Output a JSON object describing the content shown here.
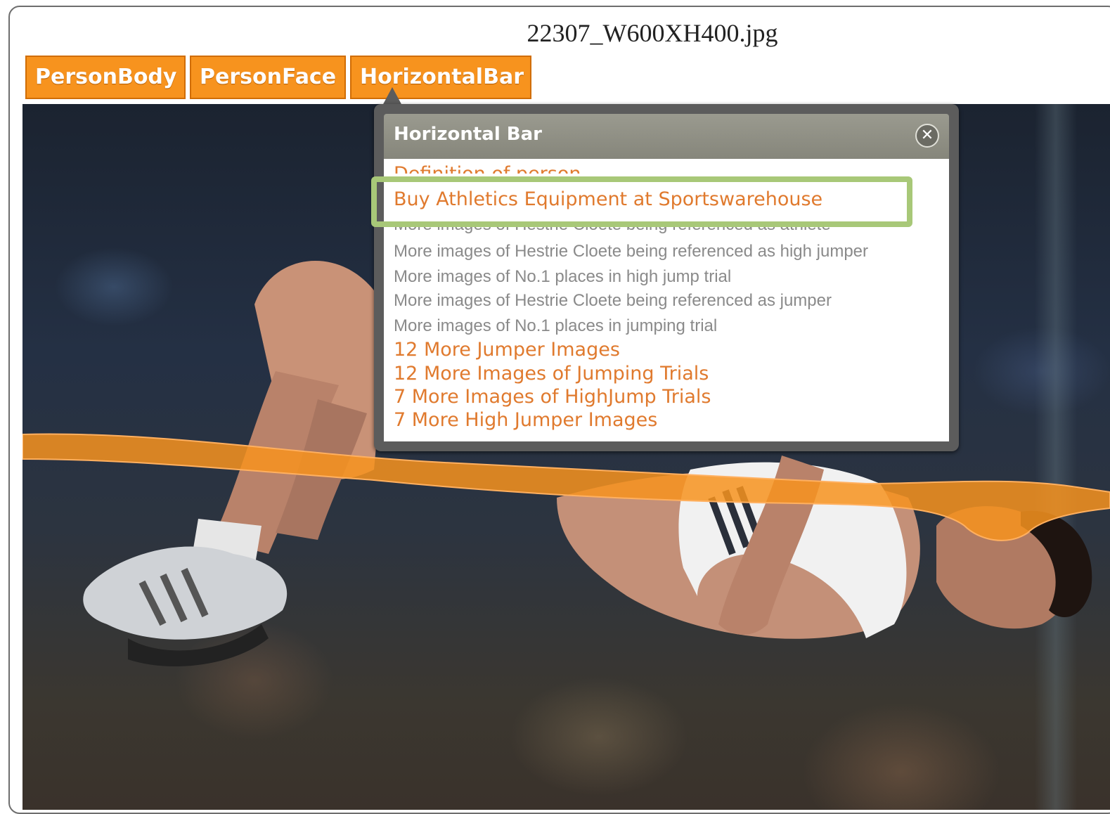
{
  "window": {
    "file_title": "22307_W600XH400.jpg"
  },
  "tabs": [
    {
      "label": "PersonBody"
    },
    {
      "label": "PersonFace"
    },
    {
      "label": "HorizontalBar"
    }
  ],
  "popup": {
    "title": "Horizontal Bar",
    "close_icon": "close-icon",
    "entries": [
      {
        "text": "Definition of person",
        "style": "link-partially-hidden"
      },
      {
        "text": "Buy Athletics Equipment at Sportswarehouse",
        "style": "link",
        "highlighted": true
      },
      {
        "text": "More images of Hestrie Cloete being referenced as athlete",
        "style": "gray-partially-hidden"
      },
      {
        "text": "More images of Hestrie Cloete being referenced as high jumper",
        "style": "gray"
      },
      {
        "text": "More images of No.1 places in high jump trial",
        "style": "gray"
      },
      {
        "text": "More images of Hestrie Cloete being referenced as jumper",
        "style": "gray"
      },
      {
        "text": "More images of No.1 places in jumping trial",
        "style": "gray"
      },
      {
        "text": "12 More Jumper Images",
        "style": "link"
      },
      {
        "text": "12 More Images of Jumping Trials",
        "style": "link"
      },
      {
        "text": "7 More Images of HighJump Trials",
        "style": "link"
      },
      {
        "text": "7 More High Jumper Images",
        "style": "link"
      }
    ]
  },
  "colors": {
    "tab_orange": "#f7931e",
    "link_orange": "#e07a2e",
    "highlight_green": "#a8c878",
    "bar_overlay": "#f7931e"
  }
}
